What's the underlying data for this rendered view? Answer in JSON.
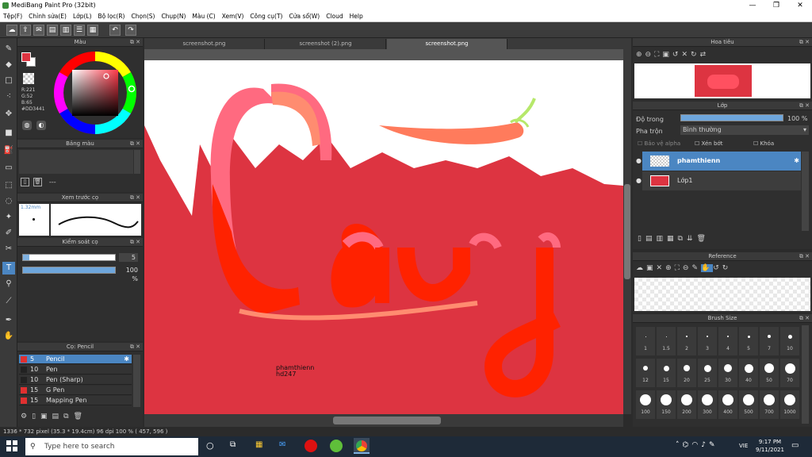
{
  "window": {
    "title": "MediBang Paint Pro (32bit)",
    "min": "—",
    "max": "❐",
    "close": "✕"
  },
  "menu": [
    "Tệp(F)",
    "Chỉnh sửa(E)",
    "Lớp(L)",
    "Bộ lọc(R)",
    "Chọn(S)",
    "Chụp(N)",
    "Màu (C)",
    "Xem(V)",
    "Công cụ(T)",
    "Cửa sổ(W)",
    "Cloud",
    "Help"
  ],
  "panels": {
    "color": "Màu",
    "palette": "Bảng màu",
    "brush_preview": "Xem trước cọ",
    "control": "Kiểm soát cọ",
    "brush": "Cọ: Pencil",
    "navigator": "Hoa tiêu",
    "layer": "Lớp",
    "reference": "Reference",
    "brush_size": "Brush Size"
  },
  "color": {
    "r": "R:221",
    "g": "G:52",
    "b": "B:65",
    "hex": "#DD3441",
    "fg": "#dd3441"
  },
  "palette": {
    "dash": "---"
  },
  "brush_preview": {
    "size": "1.32mm"
  },
  "control": {
    "size_value": "5",
    "opacity_value": "100 %",
    "opacity_fraction": 1.0
  },
  "brushes": [
    {
      "size": "5",
      "name": "Pencil",
      "color": "#e03030",
      "active": true
    },
    {
      "size": "10",
      "name": "Pen",
      "color": "#222222"
    },
    {
      "size": "10",
      "name": "Pen (Sharp)",
      "color": "#222222"
    },
    {
      "size": "15",
      "name": "G Pen",
      "color": "#e03030"
    },
    {
      "size": "15",
      "name": "Mapping Pen",
      "color": "#e03030"
    }
  ],
  "tabs": [
    "screenshot.png",
    "screenshot (2).png",
    "screenshot.png"
  ],
  "canvas": {
    "signature_line1": "phamthienn",
    "signature_line2": "hd247"
  },
  "layer": {
    "opacity_label": "Độ trong",
    "opacity_value": "100 %",
    "blend_label": "Pha trộn",
    "blend_value": "Bình thường",
    "protect_alpha": "Bảo vệ alpha",
    "clipping": "Xén bớt",
    "lock": "Khóa",
    "layers": [
      {
        "name": "phamthienn",
        "active": true
      },
      {
        "name": "Lớp1",
        "active": false
      }
    ]
  },
  "brush_sizes": [
    "1",
    "1.5",
    "2",
    "3",
    "4",
    "5",
    "7",
    "10",
    "12",
    "15",
    "20",
    "25",
    "30",
    "40",
    "50",
    "70",
    "100",
    "150",
    "200",
    "300",
    "400",
    "500",
    "700",
    "1000"
  ],
  "status": "1336 * 732 pixel   (35.3 * 19.4cm)   96 dpi   100 %   ( 457, 596 )",
  "taskbar": {
    "search_placeholder": "Type here to search",
    "time": "9:17 PM",
    "date": "9/11/2021",
    "lang": "VIE"
  }
}
